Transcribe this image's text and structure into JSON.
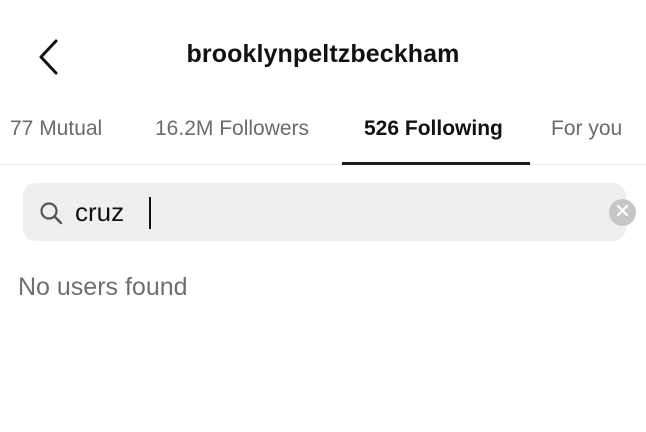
{
  "header": {
    "title": "brooklynpeltzbeckham",
    "back_icon": "chevron-left-icon"
  },
  "tabs": [
    {
      "label": "77 Mutual",
      "active": false
    },
    {
      "label": "16.2M Followers",
      "active": false
    },
    {
      "label": "526 Following",
      "active": true
    },
    {
      "label": "For you",
      "active": false
    }
  ],
  "search": {
    "icon": "search-icon",
    "value": "cruz",
    "clear_icon": "clear-x-icon"
  },
  "results": {
    "empty_message": "No users found"
  },
  "colors": {
    "text_primary": "#111111",
    "text_secondary": "#6b6b6b",
    "search_background": "#efefef",
    "active_indicator": "#1c1c1c"
  }
}
